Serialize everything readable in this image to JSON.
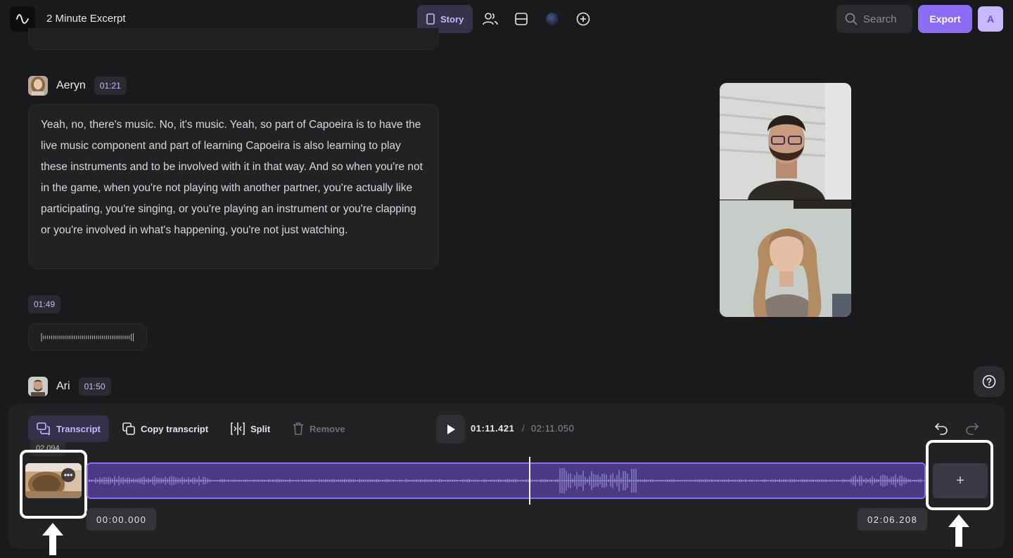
{
  "header": {
    "project_title": "2 Minute Excerpt",
    "story_tab_label": "Story",
    "search_placeholder": "Search",
    "export_label": "Export",
    "avatar_initial": "A"
  },
  "transcript": {
    "blocks": [
      {
        "speaker": "Aeryn",
        "timestamp": "01:21",
        "text": "Yeah, no, there's music. No, it's music. Yeah, so part of Capoeira is to have the live music component and part of learning Capoeira is also learning to play these instruments and to be involved with it in that way. And so when you're not in the game, when you're not playing with another partner, you're actually like participating, you're singing, or you're playing an instrument or you're clapping or you're involved in what's happening, you're not just watching."
      },
      {
        "timestamp": "01:49",
        "type": "audio"
      },
      {
        "speaker": "Ari",
        "timestamp": "01:50"
      }
    ]
  },
  "toolbar": {
    "transcript_label": "Transcript",
    "copy_transcript_label": "Copy transcript",
    "split_label": "Split",
    "remove_label": "Remove"
  },
  "player": {
    "current_time": "01:11.421",
    "separator": "/",
    "total_time": "02:11.050"
  },
  "timeline": {
    "clip_duration": "02.094",
    "start_time": "00:00.000",
    "end_time": "02:06.208",
    "add_label": "+"
  },
  "colors": {
    "accent": "#8b6cf5",
    "track": "#4a3a86",
    "background": "#1a1a1c"
  }
}
